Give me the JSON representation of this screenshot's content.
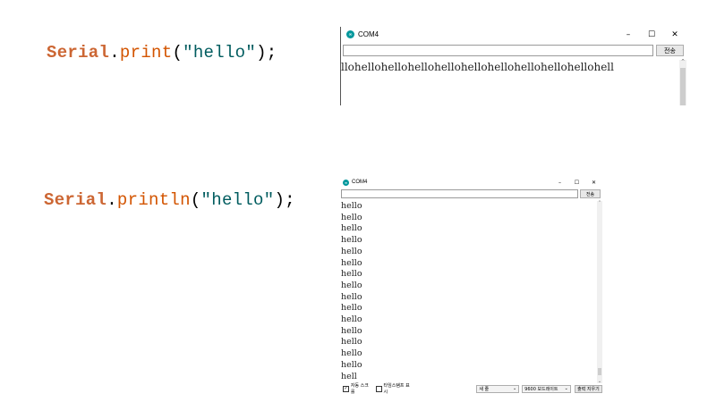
{
  "snippets": {
    "print": {
      "object": "Serial",
      "dot": ".",
      "method": "print",
      "open": "(",
      "string": "\"hello\"",
      "close": ");"
    },
    "println": {
      "object": "Serial",
      "dot": ".",
      "method": "println",
      "open": "(",
      "string": "\"hello\"",
      "close": ");"
    }
  },
  "window_top": {
    "title": "COM4",
    "controls": {
      "minimize": "–",
      "maximize": "☐",
      "close": "✕"
    },
    "send_label": "전송",
    "output_text": "llohellohellohellohellohellohellohellohellohellohell"
  },
  "window_bottom": {
    "title": "COM4",
    "controls": {
      "minimize": "–",
      "maximize": "☐",
      "close": "✕"
    },
    "send_label": "전송",
    "output_lines": [
      "hello",
      "hello",
      "hello",
      "hello",
      "hello",
      "hello",
      "hello",
      "hello",
      "hello",
      "hello",
      "hello",
      "hello",
      "hello",
      "hello",
      "hello",
      "hell"
    ],
    "footer": {
      "autoscroll_label": "자동 스크롤",
      "autoscroll_checked": true,
      "timestamp_label": "타임스탬프 표시",
      "timestamp_checked": false,
      "line_ending": "새 줄",
      "baud_rate": "9600 보드레이트",
      "clear_output": "출력 지우기"
    }
  },
  "colors": {
    "arduino_teal": "#00979c",
    "keyword": "#cc6633",
    "string": "#005c5f"
  },
  "icons": [
    "arduino-icon",
    "minimize-icon",
    "maximize-icon",
    "close-icon",
    "checkbox-icon",
    "chevron-down-icon"
  ]
}
